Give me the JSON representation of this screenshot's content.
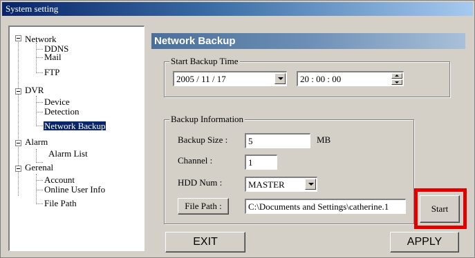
{
  "window": {
    "title": "System setting"
  },
  "tree": {
    "items": [
      {
        "label": "Network",
        "level": 0
      },
      {
        "label": "DDNS",
        "level": 1
      },
      {
        "label": "Mail",
        "level": 1
      },
      {
        "label": "FTP",
        "level": 1
      },
      {
        "label": "DVR",
        "level": 0
      },
      {
        "label": "Device",
        "level": 1
      },
      {
        "label": "Detection",
        "level": 1
      },
      {
        "label": "Network Backup",
        "level": 1,
        "selected": true
      },
      {
        "label": "Alarm",
        "level": 0
      },
      {
        "label": "Alarm List",
        "level": 1
      },
      {
        "label": "Gerenal",
        "level": 0
      },
      {
        "label": "Account",
        "level": 1
      },
      {
        "label": "Online User Info",
        "level": 1
      },
      {
        "label": "File Path",
        "level": 1
      }
    ]
  },
  "panel": {
    "title": "Network Backup",
    "start_backup_time": {
      "legend": "Start Backup Time",
      "date": "2005 / 11 / 17",
      "time": "20 : 00 : 00"
    },
    "backup_info": {
      "legend": "Backup Information",
      "size_label": "Backup Size :",
      "size_value": "5",
      "size_unit": "MB",
      "channel_label": "Channel :",
      "channel_value": "1",
      "hdd_label": "HDD Num :",
      "hdd_value": "MASTER",
      "file_path_button": "File Path :",
      "file_path_value": "C:\\Documents and Settings\\catherine.1"
    },
    "start_button": "Start",
    "exit_button": "EXIT",
    "apply_button": "APPLY"
  },
  "colors": {
    "highlight": "#e00000",
    "header": "#4b6f9a",
    "selection": "#0a246a"
  }
}
